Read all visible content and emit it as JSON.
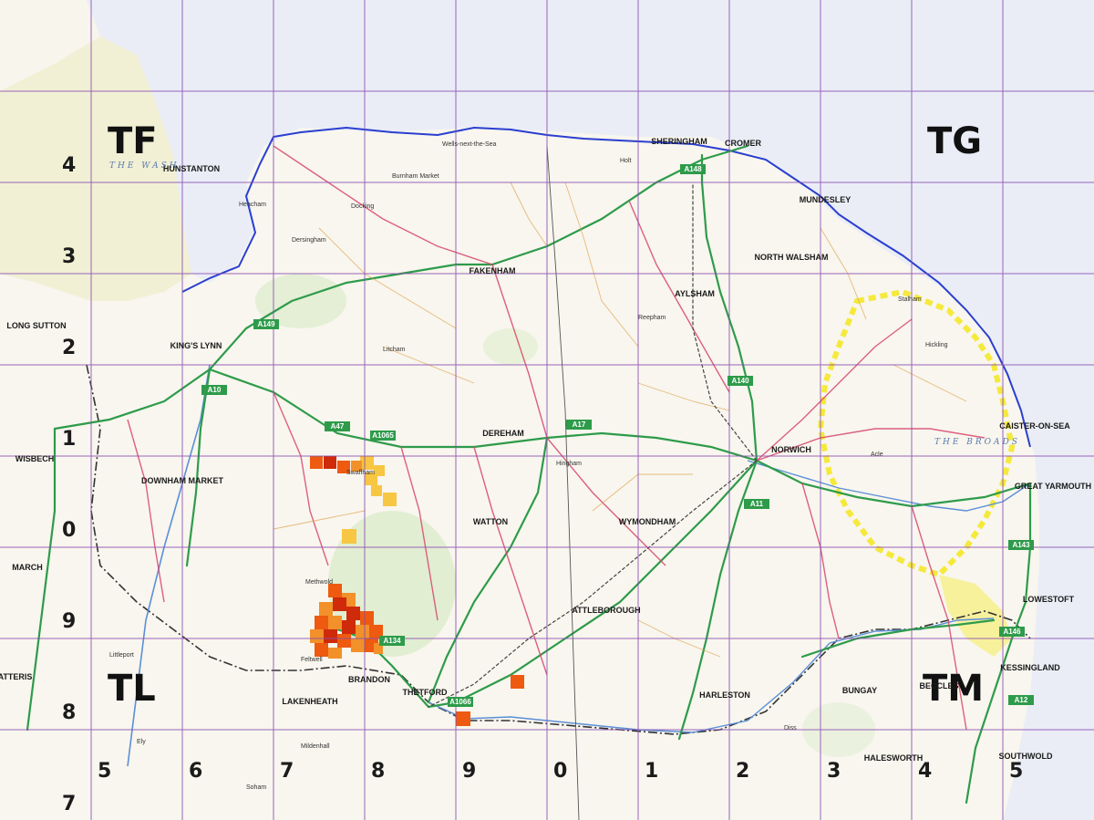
{
  "map": {
    "squares": [
      {
        "id": "TF",
        "label": "TF"
      },
      {
        "id": "TG",
        "label": "TG"
      },
      {
        "id": "TL",
        "label": "TL"
      },
      {
        "id": "TM",
        "label": "TM"
      }
    ],
    "eastings": [
      "5",
      "6",
      "7",
      "8",
      "9",
      "0",
      "1",
      "2",
      "3",
      "4",
      "5"
    ],
    "northings": [
      "4",
      "3",
      "2",
      "1",
      "0",
      "9",
      "8",
      "7"
    ],
    "sea_labels": [
      "THE WASH",
      "THE BROADS"
    ],
    "towns": [
      "HUNSTANTON",
      "SHERINGHAM",
      "CROMER",
      "FAKENHAM",
      "KING'S LYNN",
      "DEREHAM",
      "NORWICH",
      "WISBECH",
      "DOWNHAM MARKET",
      "MARCH",
      "THETFORD",
      "WATTON",
      "WYMONDHAM",
      "ATTLEBOROUGH",
      "GREAT YARMOUTH",
      "LOWESTOFT",
      "NORTH WALSHAM",
      "AYLSHAM",
      "BUNGAY",
      "BECCLES",
      "HARLESTON",
      "HALESWORTH",
      "SOUTHWOLD",
      "LAKENHEATH",
      "BRANDON",
      "MUNDESLEY",
      "CAISTER-ON-SEA",
      "KESSINGLAND",
      "LONG SUTTON",
      "CHATTERIS"
    ],
    "small_places": [
      "Docking",
      "Burnham Market",
      "Wells-next-the-Sea",
      "Holt",
      "Heacham",
      "Dersingham",
      "Swaffham",
      "Litcham",
      "Reepham",
      "Acle",
      "Stalham",
      "Hickling",
      "Diss",
      "Methwold",
      "Feltwell",
      "Mildenhall",
      "Soham",
      "Ely",
      "Littleport",
      "Hingham"
    ],
    "roads": [
      "A47",
      "A148",
      "A149",
      "A140",
      "A11",
      "A1065",
      "A134",
      "A143",
      "A146",
      "A10",
      "A17",
      "A1066",
      "A12"
    ]
  }
}
